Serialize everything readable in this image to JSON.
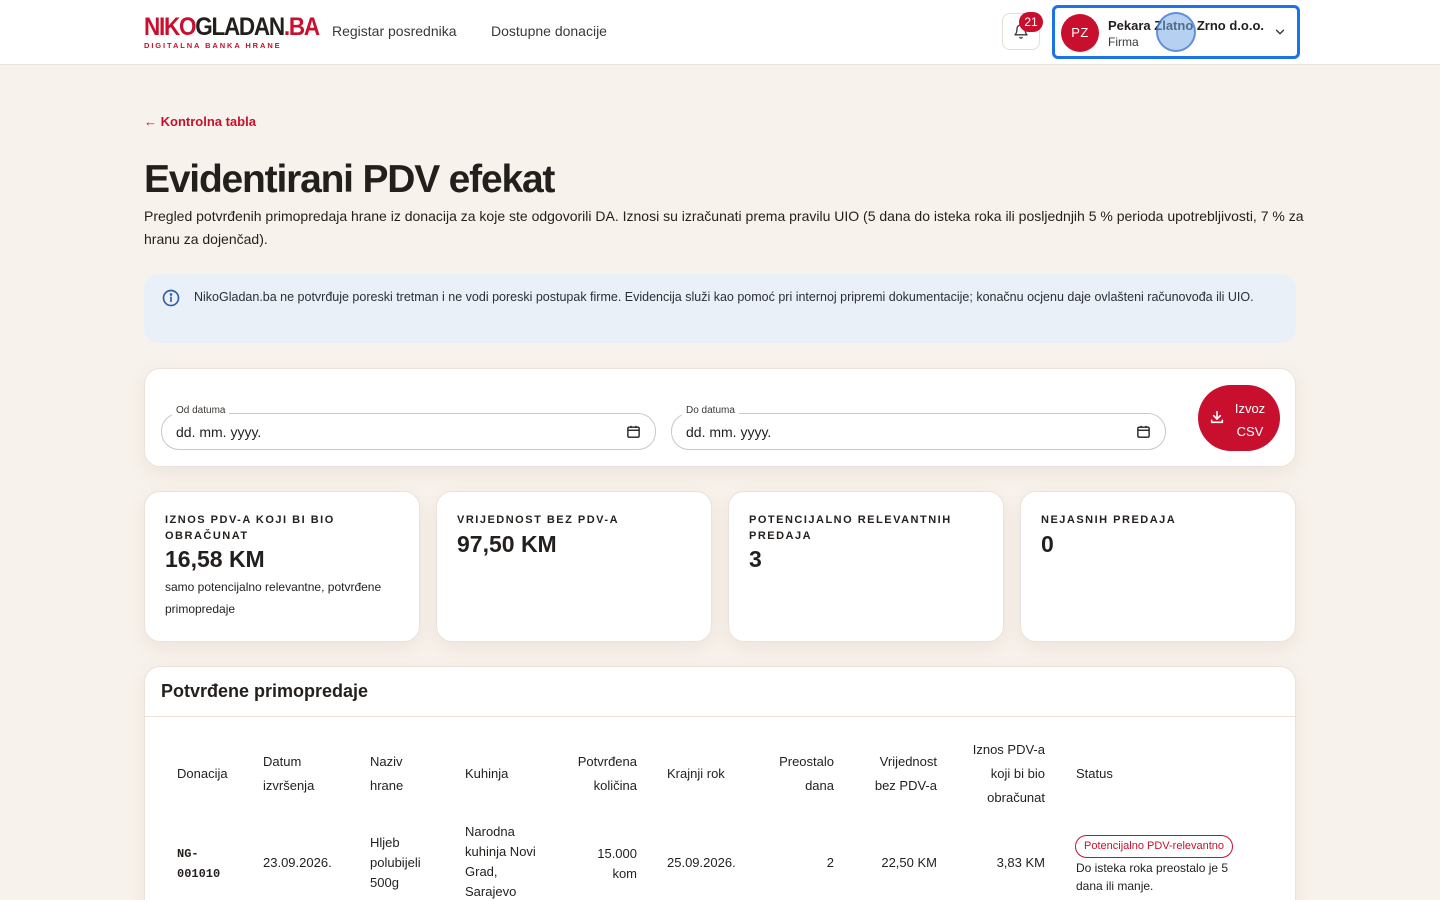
{
  "header": {
    "logo_main_1": "NIKO",
    "logo_main_2": "GLADAN",
    "logo_main_3": ".BA",
    "logo_sub": "DIGITALNA BANKA HRANE",
    "nav": [
      "Registar posrednika",
      "Dostupne donacije"
    ],
    "notification_count": "21",
    "user": {
      "initials": "PZ",
      "name": "Pekara Zlatno Zrno d.o.o.",
      "role": "Firma"
    }
  },
  "page": {
    "back_link": "← Kontrolna tabla",
    "title": "Evidentirani PDV efekat",
    "description": "Pregled potvrđenih primopredaja hrane iz donacija za koje ste odgovorili DA. Iznosi su izračunati prema pravilu UIO (5 dana do isteka roka ili posljednjih 5 % perioda upotrebljivosti, 7 % za hranu za dojenčad).",
    "info": "NikoGladan.ba ne potvrđuje poreski tretman i ne vodi poreski postupak firme. Evidencija služi kao pomoć pri internoj pripremi dokumentacije; konačnu ocjenu daje ovlašteni računovođa ili UIO."
  },
  "filters": {
    "from_label": "Od datuma",
    "from_value": "dd. mm. yyyy.",
    "to_label": "Do datuma",
    "to_value": "dd. mm. yyyy.",
    "export_label": "Izvoz CSV"
  },
  "stats": [
    {
      "label": "Iznos PDV-a koji bi bio obračunat",
      "value": "16,58 KM",
      "note": "samo potencijalno relevantne, potvrđene primopredaje"
    },
    {
      "label": "Vrijednost bez PDV-a",
      "value": "97,50 KM",
      "note": ""
    },
    {
      "label": "Potencijalno relevantnih predaja",
      "value": "3",
      "note": ""
    },
    {
      "label": "Nejasnih predaja",
      "value": "0",
      "note": ""
    }
  ],
  "table": {
    "title": "Potvrđene primopredaje",
    "columns": [
      "Donacija",
      "Datum izvršenja",
      "Naziv hrane",
      "Kuhinja",
      "Potvrđena količina",
      "Krajnji rok",
      "Preostalo dana",
      "Vrijednost bez PDV-a",
      "Iznos PDV-a koji bi bio obračunat",
      "Status"
    ],
    "rows": [
      {
        "donation": "NG-001010",
        "date": "23.09.2026.",
        "food": "Hljeb polubijeli 500g",
        "kitchen": "Narodna kuhinja Novi Grad, Sarajevo",
        "quantity": "15.000 kom",
        "deadline": "25.09.2026.",
        "days_left": "2",
        "value": "22,50 KM",
        "vat": "3,83 KM",
        "status": "Potencijalno PDV-relevantno",
        "status_note": "Do isteka roka preostalo je 5 dana ili manje."
      }
    ]
  },
  "colors": {
    "brand": "#c8102e",
    "background": "#f8f2ec",
    "info_bg": "#eaf0f8",
    "focus": "#1a73e8"
  }
}
